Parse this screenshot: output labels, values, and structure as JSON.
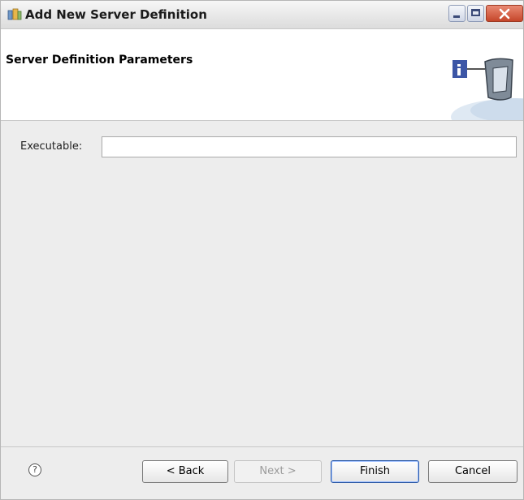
{
  "window": {
    "title": "Add New Server Definition"
  },
  "header": {
    "heading": "Server Definition Parameters"
  },
  "form": {
    "executable_label": "Executable:",
    "executable_value": ""
  },
  "footer": {
    "help_glyph": "?",
    "back_label": "< Back",
    "next_label": "Next >",
    "finish_label": "Finish",
    "cancel_label": "Cancel"
  },
  "icons": {
    "app": "server-definition-icon",
    "banner": "server-info-banner-icon",
    "help": "help-icon",
    "minimize": "minimize-icon",
    "maximize": "maximize-icon",
    "close": "close-icon"
  },
  "colors": {
    "title_bar": "#e9e9e9",
    "close_button": "#c6462a",
    "info_badge": "#3c56a6"
  }
}
